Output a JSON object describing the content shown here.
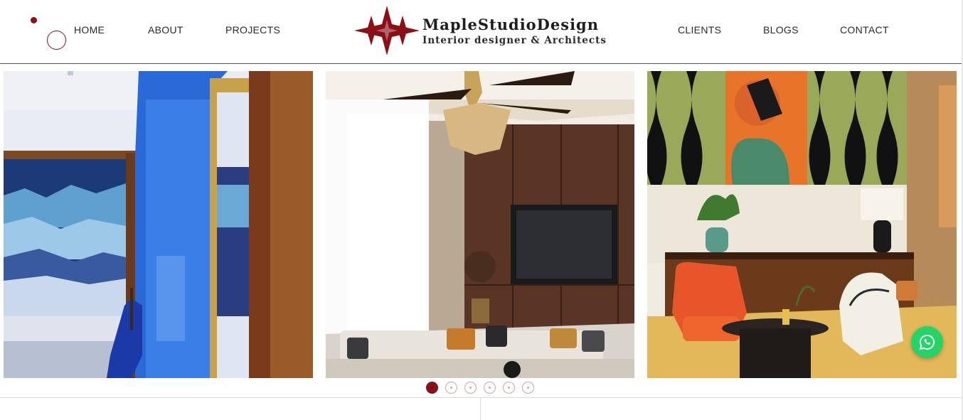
{
  "nav": {
    "left": [
      {
        "label": "HOME"
      },
      {
        "label": "ABOUT"
      },
      {
        "label": "PROJECTS"
      }
    ],
    "right": [
      {
        "label": "CLIENTS"
      },
      {
        "label": "BLOGS"
      },
      {
        "label": "CONTACT"
      }
    ]
  },
  "logo": {
    "title": "MapleStudioDesign",
    "subtitle": "Interior designer & Architects",
    "icon": "four-point-stars-icon"
  },
  "carousel": {
    "slides": [
      {
        "name": "blue-bedroom-mirror"
      },
      {
        "name": "living-room-ceiling-fan"
      },
      {
        "name": "retro-lounge-orange-chair"
      }
    ],
    "dots": 6,
    "active_dot": 1
  },
  "colors": {
    "brand": "#8b0f14",
    "whatsapp": "#25d366"
  },
  "floating": {
    "whatsapp_icon": "whatsapp-icon"
  }
}
